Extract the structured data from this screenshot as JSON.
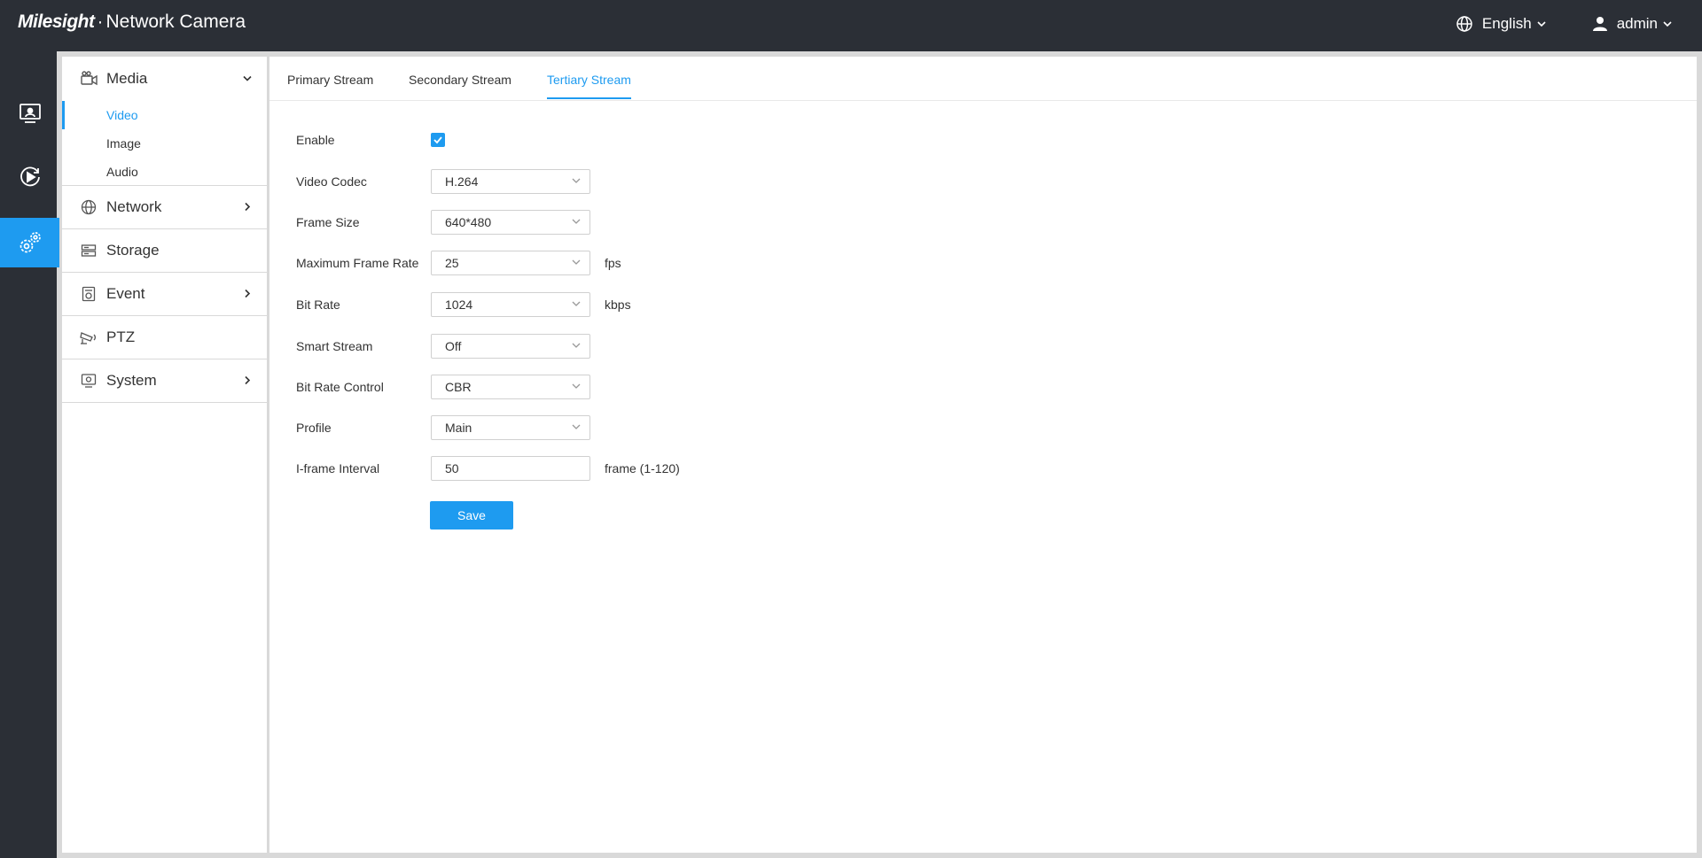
{
  "header": {
    "brand_logo": "Milesight",
    "brand_separator": "·",
    "brand_product": "Network Camera",
    "language": "English",
    "user": "admin"
  },
  "rail": {
    "items": [
      {
        "icon": "live-view-monitor-icon"
      },
      {
        "icon": "playback-icon"
      },
      {
        "icon": "settings-gears-icon",
        "active": true
      }
    ]
  },
  "sidebar": {
    "items": [
      {
        "label": "Media",
        "icon": "camera-icon",
        "expanded": true,
        "children": [
          {
            "label": "Video",
            "active": true
          },
          {
            "label": "Image"
          },
          {
            "label": "Audio"
          }
        ]
      },
      {
        "label": "Network",
        "icon": "globe-icon"
      },
      {
        "label": "Storage",
        "icon": "storage-icon"
      },
      {
        "label": "Event",
        "icon": "event-icon"
      },
      {
        "label": "PTZ",
        "icon": "ptz-icon"
      },
      {
        "label": "System",
        "icon": "system-icon"
      }
    ]
  },
  "tabs": [
    {
      "label": "Primary Stream"
    },
    {
      "label": "Secondary Stream"
    },
    {
      "label": "Tertiary Stream",
      "active": true
    }
  ],
  "form": {
    "enable": {
      "label": "Enable",
      "checked": true
    },
    "video_codec": {
      "label": "Video Codec",
      "value": "H.264"
    },
    "frame_size": {
      "label": "Frame Size",
      "value": "640*480"
    },
    "max_frame_rate": {
      "label": "Maximum Frame Rate",
      "value": "25",
      "unit": "fps"
    },
    "bit_rate": {
      "label": "Bit Rate",
      "value": "1024",
      "unit": "kbps"
    },
    "smart_stream": {
      "label": "Smart Stream",
      "value": "Off"
    },
    "bit_rate_control": {
      "label": "Bit Rate Control",
      "value": "CBR"
    },
    "profile": {
      "label": "Profile",
      "value": "Main"
    },
    "iframe_interval": {
      "label": "I-frame Interval",
      "value": "50",
      "unit": "frame (1-120)"
    },
    "save_label": "Save"
  },
  "colors": {
    "accent": "#1e9bf0",
    "header_bg": "#2b2f36",
    "page_bg": "#d9d9d9"
  }
}
